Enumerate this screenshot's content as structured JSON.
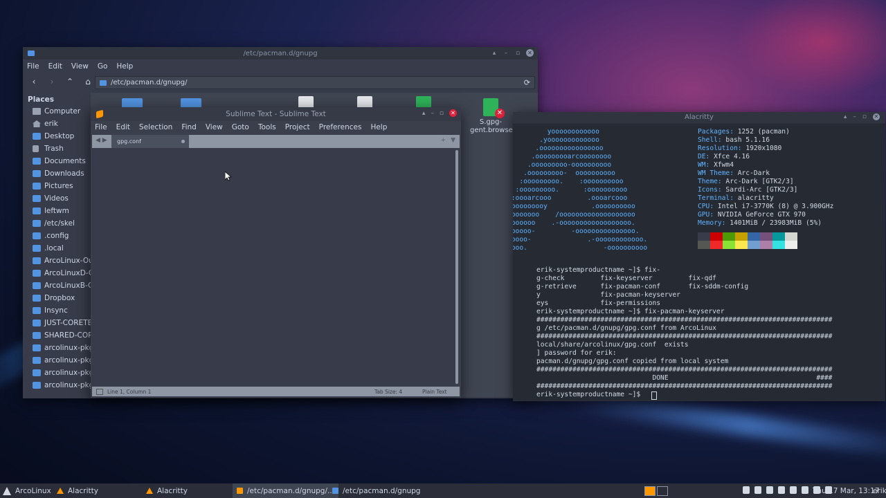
{
  "thunar": {
    "title": "/etc/pacman.d/gnupg",
    "menu": [
      "File",
      "Edit",
      "View",
      "Go",
      "Help"
    ],
    "path": "/etc/pacman.d/gnupg/",
    "sidebar_heading": "Places",
    "sidebar_items": [
      {
        "label": "Computer",
        "icon": "computer-icon"
      },
      {
        "label": "erik",
        "icon": "home-icon"
      },
      {
        "label": "Desktop",
        "icon": "folder-icon"
      },
      {
        "label": "Trash",
        "icon": "trash-icon"
      },
      {
        "label": "Documents",
        "icon": "folder-icon"
      },
      {
        "label": "Downloads",
        "icon": "folder-icon"
      },
      {
        "label": "Pictures",
        "icon": "folder-icon"
      },
      {
        "label": "Videos",
        "icon": "folder-icon"
      },
      {
        "label": "leftwm",
        "icon": "folder-icon"
      },
      {
        "label": "/etc/skel",
        "icon": "folder-icon"
      },
      {
        "label": ".config",
        "icon": "folder-icon"
      },
      {
        "label": ".local",
        "icon": "folder-icon"
      },
      {
        "label": "ArcoLinux-Out",
        "icon": "folder-icon"
      },
      {
        "label": "ArcoLinuxD-Ou",
        "icon": "folder-icon"
      },
      {
        "label": "ArcoLinuxB-Ou",
        "icon": "folder-icon"
      },
      {
        "label": "Dropbox",
        "icon": "folder-icon"
      },
      {
        "label": "Insync",
        "icon": "folder-icon"
      },
      {
        "label": "JUST-CORETEA",
        "icon": "folder-icon"
      },
      {
        "label": "SHARED-CORE",
        "icon": "folder-icon"
      },
      {
        "label": "arcolinux-pkgl",
        "icon": "folder-icon"
      },
      {
        "label": "arcolinux-pkgl",
        "icon": "folder-icon"
      },
      {
        "label": "arcolinux-pkgl",
        "icon": "folder-icon"
      },
      {
        "label": "arcolinux-pkgl",
        "icon": "folder-icon"
      }
    ],
    "file_label_partial": "S.gpg-\ngent.browser"
  },
  "sublime": {
    "title": "Sublime Text - Sublime Text",
    "menu": [
      "File",
      "Edit",
      "Selection",
      "Find",
      "View",
      "Goto",
      "Tools",
      "Project",
      "Preferences",
      "Help"
    ],
    "tab": "gpg.conf",
    "status_position": "Line 1, Column 1",
    "status_tabsize": "Tab Size: 4",
    "status_syntax": "Plain Text"
  },
  "alacritty": {
    "title": "Alacritty",
    "logo_lines": [
      "          yoooooooooooo",
      "        .yooooooooooooo",
      "       .oooooooooooooooo",
      "      .ooooooooarcoooooooo",
      "     .ooooooooo-oooooooooo",
      "    .ooooooooo-  oooooooooo",
      "   :ooooooooo.    :oooooooooo",
      "  :ooooooooo.      :oooooooooo",
      " :oooarcooo         .oooarcooo",
      "oooooooooy           .oooooooooo",
      "oooooooo    /ooooooooooooooooooo",
      "ooooooo    .-oooooooooooooooooo.",
      "oooooo-         -ooooooooooooooo.",
      "ooooo-              .-oooooooooooo.",
      "oooo.                   -oooooooooo"
    ],
    "info": [
      {
        "key": "Packages:",
        "val": " 1252 (pacman)"
      },
      {
        "key": "Shell:",
        "val": " bash 5.1.16"
      },
      {
        "key": "Resolution:",
        "val": " 1920x1080"
      },
      {
        "key": "DE:",
        "val": " Xfce 4.16"
      },
      {
        "key": "WM:",
        "val": " Xfwm4"
      },
      {
        "key": "WM Theme:",
        "val": " Arc-Dark"
      },
      {
        "key": "Theme:",
        "val": " Arc-Dark [GTK2/3]"
      },
      {
        "key": "Icons:",
        "val": " Sardi-Arc [GTK2/3]"
      },
      {
        "key": "Terminal:",
        "val": " alacritty"
      },
      {
        "key": "CPU:",
        "val": " Intel i7-3770K (8) @ 3.900GHz"
      },
      {
        "key": "GPU:",
        "val": " NVIDIA GeForce GTX 970"
      },
      {
        "key": "Memory:",
        "val": " 1401MiB / 23983MiB (5%)"
      }
    ],
    "swatches_top": [
      "#383c4a",
      "#cc0000",
      "#4e9a06",
      "#c4a000",
      "#3465a4",
      "#75507b",
      "#06989a",
      "#d3d7cf"
    ],
    "swatches_bottom": [
      "#555753",
      "#ef2929",
      "#8ae234",
      "#fce94f",
      "#729fcf",
      "#ad7fa8",
      "#34e2e2",
      "#eeeeec"
    ],
    "lines": [
      "erik-systemproductname ~]$ fix-",
      "g-check         fix-keyserver         fix-qdf",
      "g-retrieve      fix-pacman-conf       fix-sddm-config",
      "y               fix-pacman-keyserver",
      "eys             fix-permissions",
      "erik-systemproductname ~]$ fix-pacman-keyserver",
      "##########################################################################",
      "g /etc/pacman.d/gnupg/gpg.conf from ArcoLinux",
      "##########################################################################",
      "local/share/arcolinux/gpg.conf  exists",
      "] password for erik:",
      "pacman.d/gnupg/gpg.conf copied from local system",
      "##########################################################################",
      "                             DONE                                     ####",
      "##########################################################################",
      "erik-systemproductname ~]$ "
    ]
  },
  "taskbar": {
    "menu_label": "ArcoLinux",
    "items": [
      "Alacritty",
      "Alacritty",
      "/etc/pacman.d/gnupg/...",
      "/etc/pacman.d/gnupg"
    ],
    "clock": "Thu 17 Mar, 13:17",
    "user": "erik"
  }
}
